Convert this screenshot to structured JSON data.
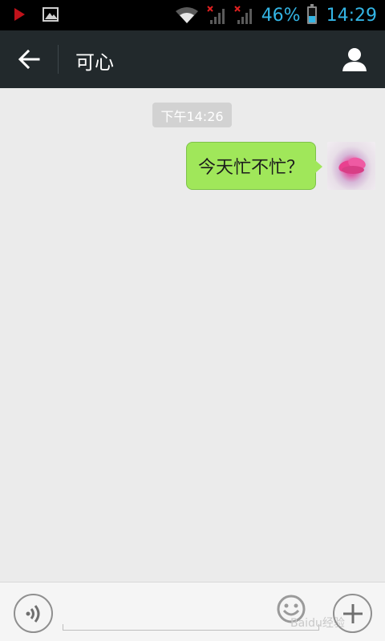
{
  "status_bar": {
    "battery_percent": "46%",
    "battery_level": 0.46,
    "time": "14:29",
    "icons": [
      "play-icon",
      "image-icon",
      "wifi-icon",
      "signal-icon",
      "signal-icon",
      "battery-icon"
    ],
    "accent_color": "#33b5e5"
  },
  "header": {
    "title": "可心",
    "back_icon": "arrow-left-icon",
    "profile_icon": "person-icon",
    "background": "#22292c"
  },
  "chat": {
    "timestamp": "下午14:26",
    "messages": [
      {
        "text": "今天忙不忙？",
        "direction": "outgoing",
        "bubble_color": "#a0e75a"
      }
    ]
  },
  "input_bar": {
    "voice_icon": "voice-icon",
    "emoji_icon": "emoji-icon",
    "plus_icon": "plus-icon",
    "input_value": "",
    "watermark": "Baidu经验"
  }
}
